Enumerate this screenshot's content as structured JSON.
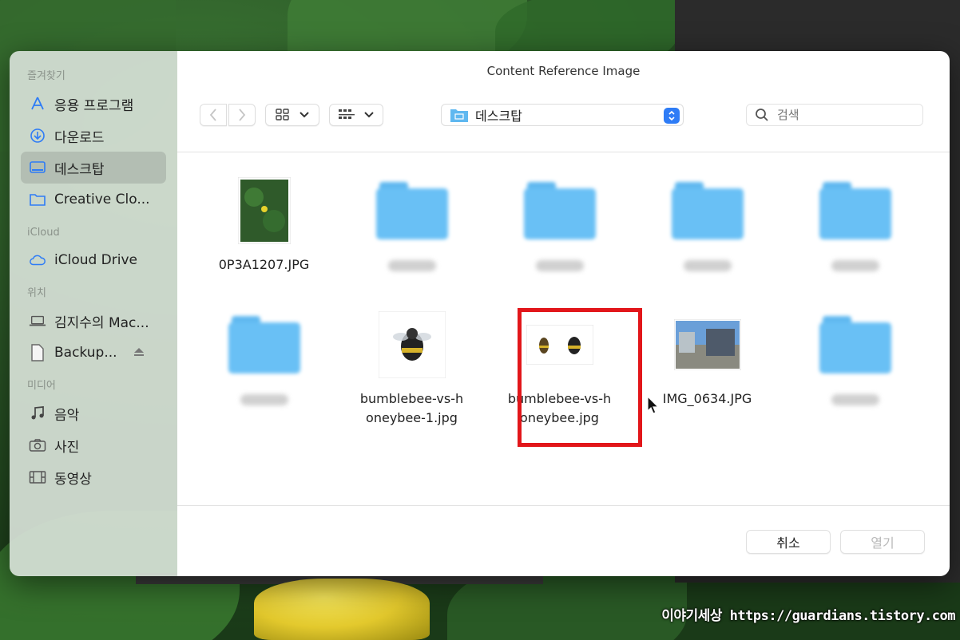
{
  "dialog": {
    "title": "Content Reference Image"
  },
  "sidebar": {
    "sections": [
      {
        "title": "즐겨찾기",
        "items": [
          {
            "label": "응용 프로그램",
            "icon": "applications-icon"
          },
          {
            "label": "다운로드",
            "icon": "download-icon"
          },
          {
            "label": "데스크탑",
            "icon": "desktop-icon",
            "active": true
          },
          {
            "label": "Creative Clo...",
            "icon": "folder-icon"
          }
        ]
      },
      {
        "title": "iCloud",
        "items": [
          {
            "label": "iCloud Drive",
            "icon": "cloud-icon"
          }
        ]
      },
      {
        "title": "위치",
        "items": [
          {
            "label": "김지수의 Mac...",
            "icon": "laptop-icon"
          },
          {
            "label": "Backup...",
            "icon": "document-icon",
            "eject": true
          }
        ]
      },
      {
        "title": "미디어",
        "items": [
          {
            "label": "음악",
            "icon": "music-icon"
          },
          {
            "label": "사진",
            "icon": "camera-icon"
          },
          {
            "label": "동영상",
            "icon": "film-icon"
          }
        ]
      }
    ]
  },
  "toolbar": {
    "location": "데스크탑",
    "search_placeholder": "검색"
  },
  "files": [
    {
      "name": "0P3A1207.JPG",
      "kind": "photo-flower"
    },
    {
      "name": "",
      "kind": "folder-blurred"
    },
    {
      "name": "",
      "kind": "folder-blurred"
    },
    {
      "name": "",
      "kind": "folder-blurred"
    },
    {
      "name": "",
      "kind": "folder-blurred"
    },
    {
      "name": "",
      "kind": "folder-blurred"
    },
    {
      "name": "bumblebee-vs-honeybee-1.jpg",
      "kind": "photo-bee",
      "selected": true
    },
    {
      "name": "bumblebee-vs-honeybee.jpg",
      "kind": "photo-two-bees"
    },
    {
      "name": "IMG_0634.JPG",
      "kind": "photo-building"
    },
    {
      "name": "",
      "kind": "folder-blurred"
    }
  ],
  "footer": {
    "cancel_label": "취소",
    "open_label": "열기"
  },
  "watermark": "이야기세상 https://guardians.tistory.com",
  "colors": {
    "accent": "#2e7cf6",
    "highlight": "#e2161a",
    "folder": "#69c0f5"
  }
}
